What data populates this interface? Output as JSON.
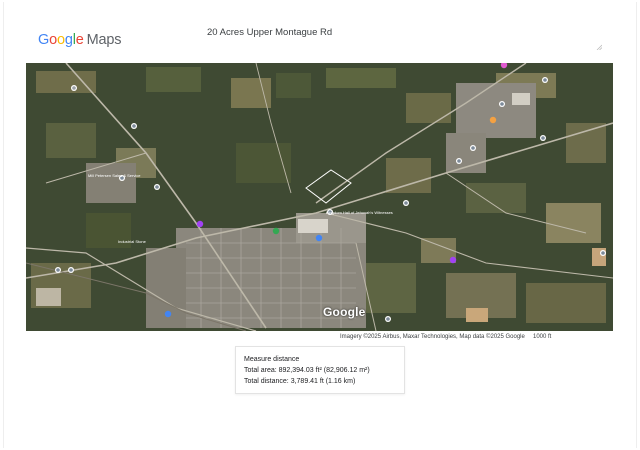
{
  "header": {
    "logo_letters": [
      {
        "char": "G",
        "color": "#4285F4"
      },
      {
        "char": "o",
        "color": "#EA4335"
      },
      {
        "char": "o",
        "color": "#FBBC05"
      },
      {
        "char": "g",
        "color": "#4285F4"
      },
      {
        "char": "l",
        "color": "#34A853"
      },
      {
        "char": "e",
        "color": "#EA4335"
      }
    ],
    "logo_product": "Maps",
    "search_value": "20 Acres Upper Montague Rd"
  },
  "map": {
    "watermark": "Google",
    "attribution": "Imagery ©2025 Airbus, Maxar Technologies, Map data ©2025 Google",
    "scale_label": "1000 ft",
    "labels": [
      "Mill Petersen Sales & Service",
      "Kingdom Hall of Jehovah's Witnesses",
      "Industrial Stone"
    ]
  },
  "measure": {
    "title": "Measure distance",
    "total_area": "Total area: 892,394.03 ft² (82,906.12 m²)",
    "total_distance": "Total distance: 3,789.41 ft (1.16 km)"
  },
  "colors": {
    "google_blue": "#4285F4",
    "google_red": "#EA4335",
    "google_yellow": "#FBBC05",
    "google_green": "#34A853",
    "map_vegetation": "#3f4a33"
  },
  "icons": [
    "resize-handle-icon",
    "map-pin-icon"
  ]
}
